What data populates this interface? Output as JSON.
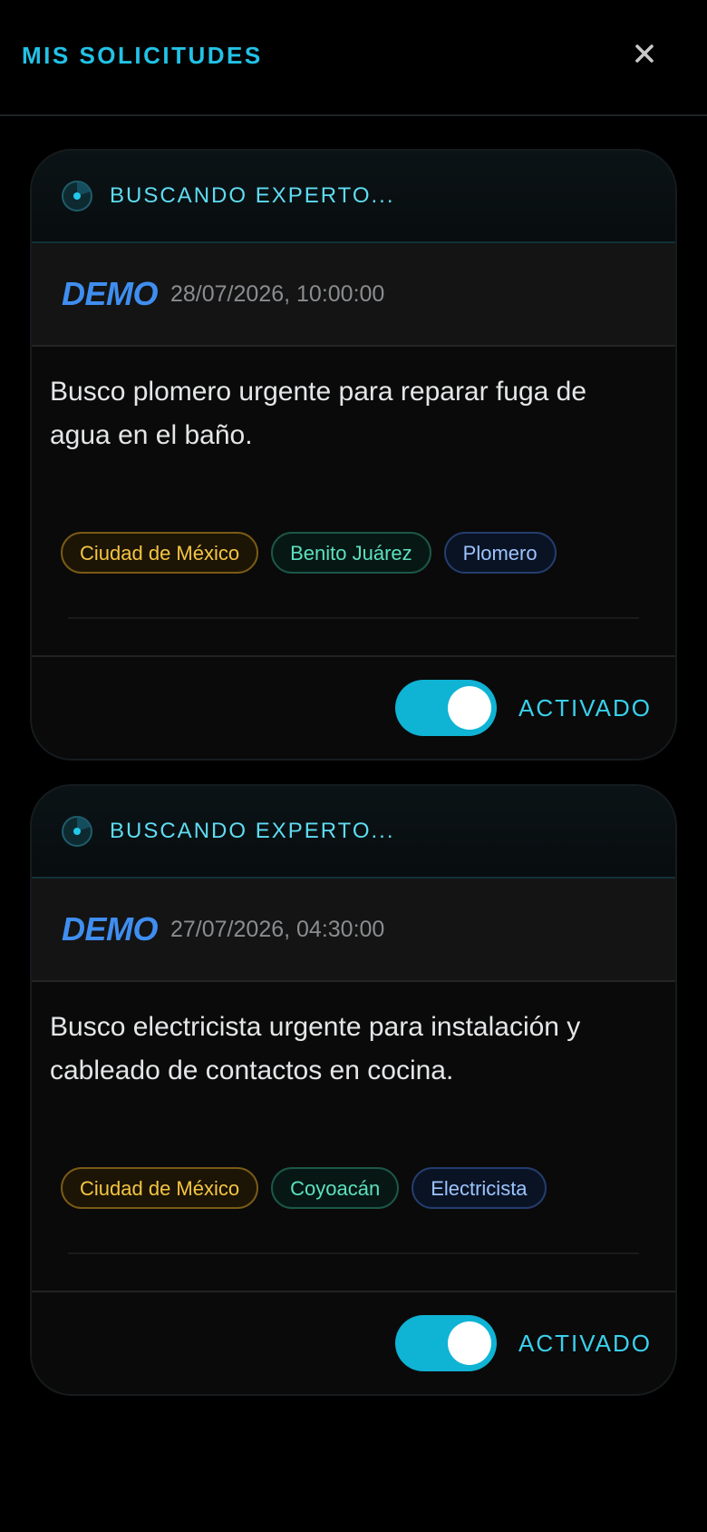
{
  "header": {
    "title": "MIS SOLICITUDES",
    "close_icon": "close-icon"
  },
  "requests": [
    {
      "status": "BUSCANDO EXPERTO...",
      "user": "DEMO",
      "timestamp": "28/07/2026, 10:00:00",
      "description": "Busco plomero urgente para reparar fuga de agua en el baño.",
      "tags": {
        "city": "Ciudad de México",
        "area": "Benito Juárez",
        "trade": "Plomero"
      },
      "toggle_on": true,
      "toggle_label": "ACTIVADO"
    },
    {
      "status": "BUSCANDO EXPERTO...",
      "user": "DEMO",
      "timestamp": "27/07/2026, 04:30:00",
      "description": "Busco electricista urgente para instalación y cableado de contactos en cocina.",
      "tags": {
        "city": "Ciudad de México",
        "area": "Coyoacán",
        "trade": "Electricista"
      },
      "toggle_on": true,
      "toggle_label": "ACTIVADO"
    }
  ],
  "colors": {
    "accent": "#22c2e6",
    "toggle": "#0fb3d4",
    "user": "#3f8ef0",
    "tag_city": "#f5c542",
    "tag_area": "#5de0c0",
    "tag_trade": "#9cc4ff"
  }
}
